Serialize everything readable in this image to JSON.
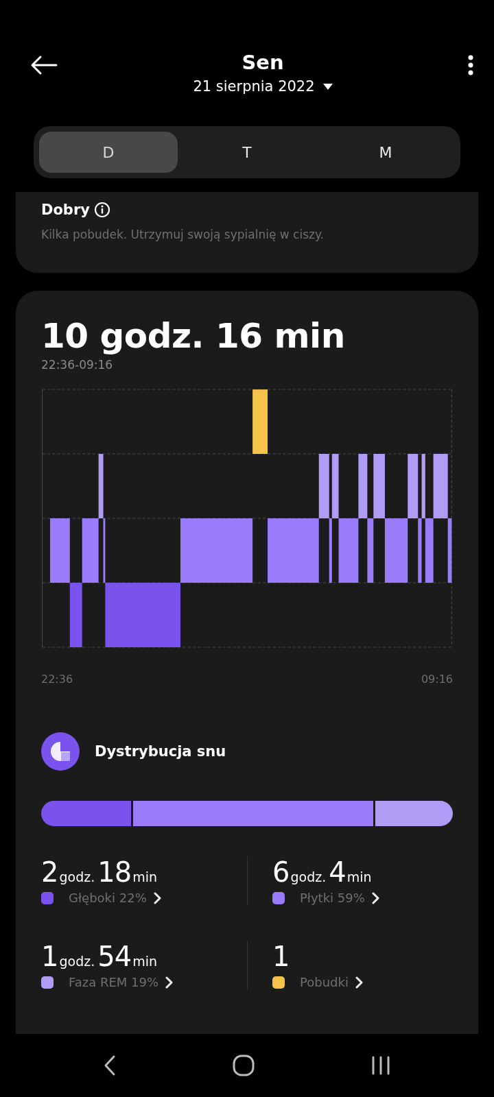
{
  "header": {
    "title": "Sen",
    "date": "21 sierpnia 2022"
  },
  "tabs": [
    {
      "label": "D",
      "selected": true
    },
    {
      "label": "T",
      "selected": false
    },
    {
      "label": "M",
      "selected": false
    }
  ],
  "quality": {
    "title": "Dobry",
    "description": "Kilka pobudek. Utrzymuj swoją sypialnię w ciszy."
  },
  "summary": {
    "duration": "10 godz. 16 min",
    "range": "22:36-09:16",
    "axis_start": "22:36",
    "axis_end": "09:16"
  },
  "distribution": {
    "title": "Dystrybucja snu",
    "segments": [
      {
        "color": "#7a52ee"
      },
      {
        "color": "#9a7bfa"
      },
      {
        "color": "#b09cf5"
      }
    ],
    "stats": [
      {
        "parts": [
          {
            "value": "2",
            "unit": "godz."
          },
          {
            "value": "18",
            "unit": "min"
          }
        ],
        "label": "Głęboki 22%",
        "color": "#7a52ee"
      },
      {
        "parts": [
          {
            "value": "6",
            "unit": "godz."
          },
          {
            "value": "4",
            "unit": "min"
          }
        ],
        "label": "Płytki 59%",
        "color": "#9a7bfa"
      },
      {
        "parts": [
          {
            "value": "1",
            "unit": "godz."
          },
          {
            "value": "54",
            "unit": "min"
          }
        ],
        "label": "Faza REM 19%",
        "color": "#b09cf5"
      },
      {
        "parts": [
          {
            "value": "1"
          }
        ],
        "label": "Pobudki",
        "color": "#f5c24a"
      }
    ]
  }
}
